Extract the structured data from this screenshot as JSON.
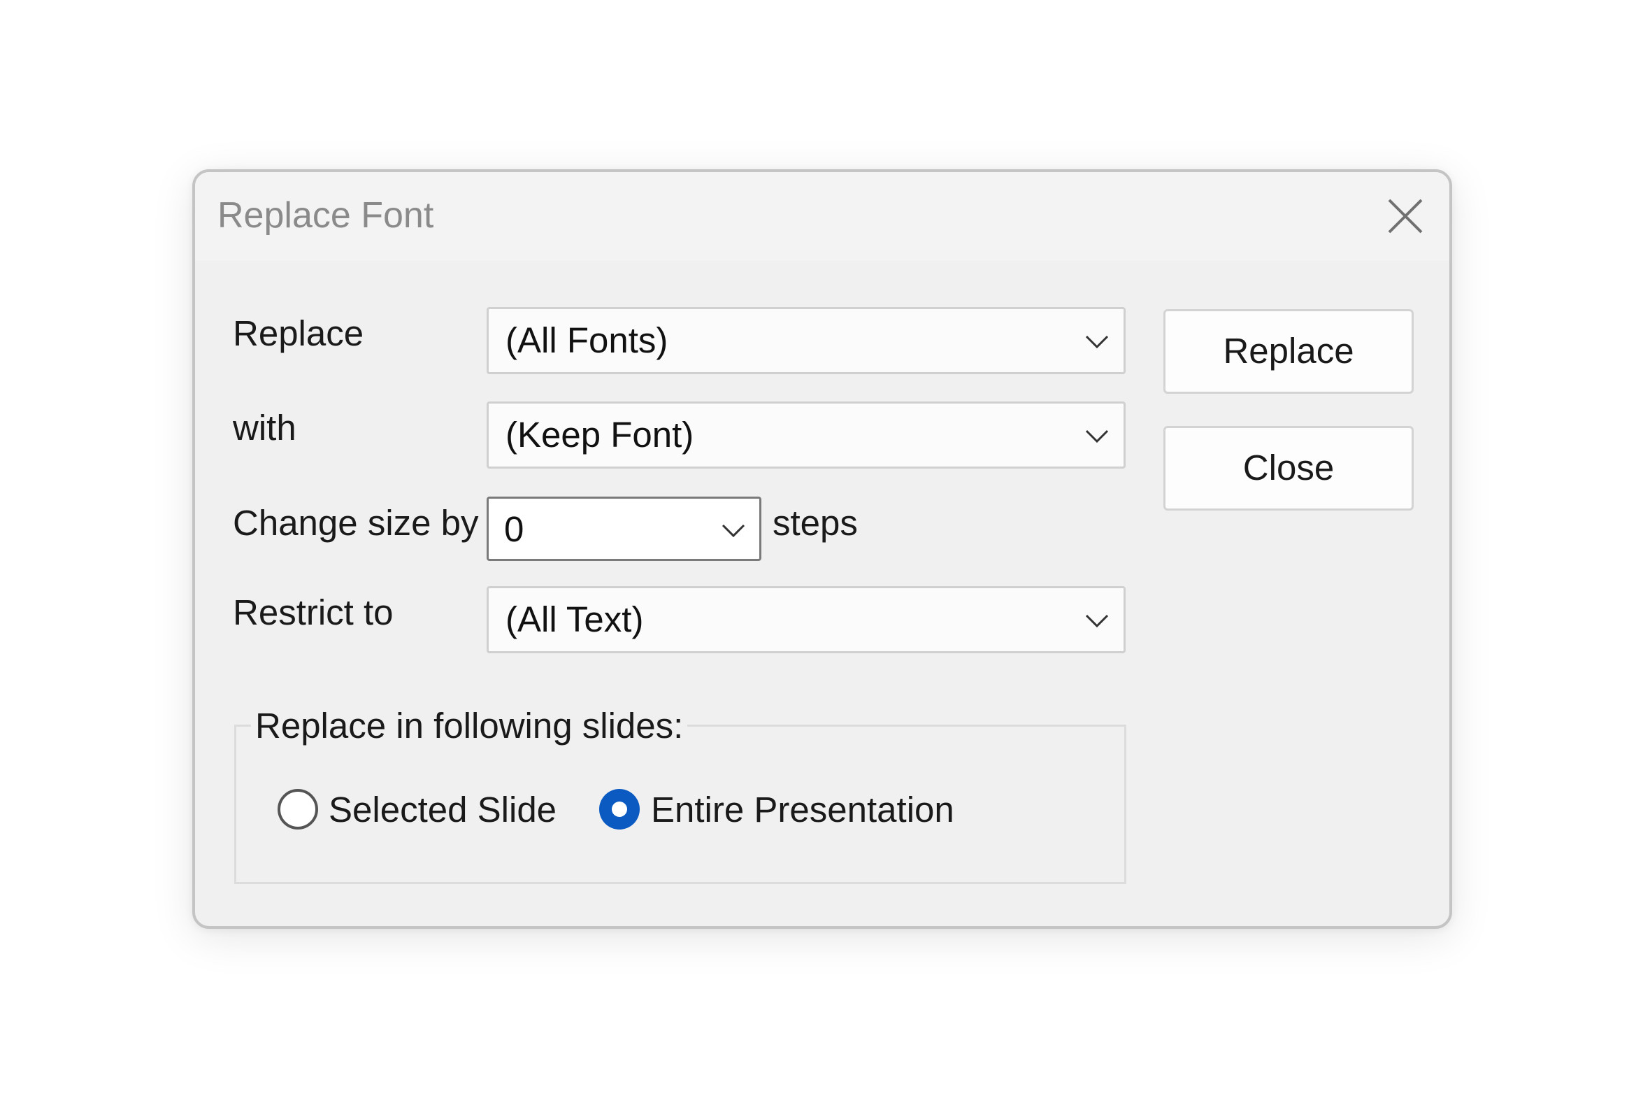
{
  "dialog": {
    "title": "Replace Font",
    "close_icon": "close-icon"
  },
  "fields": {
    "replace_label": "Replace",
    "replace_value": "(All Fonts)",
    "with_label": "with",
    "with_value": "(Keep Font)",
    "size_label": "Change size by",
    "size_value": "0",
    "size_unit": "steps",
    "restrict_label": "Restrict to",
    "restrict_value": "(All Text)"
  },
  "buttons": {
    "replace": "Replace",
    "close": "Close"
  },
  "slides_group": {
    "title": "Replace in following slides:",
    "options": [
      {
        "label": "Selected Slide",
        "selected": false
      },
      {
        "label": "Entire Presentation",
        "selected": true
      }
    ]
  },
  "colors": {
    "accent": "#0a5ac2",
    "dialog_bg": "#f0f0f0"
  }
}
